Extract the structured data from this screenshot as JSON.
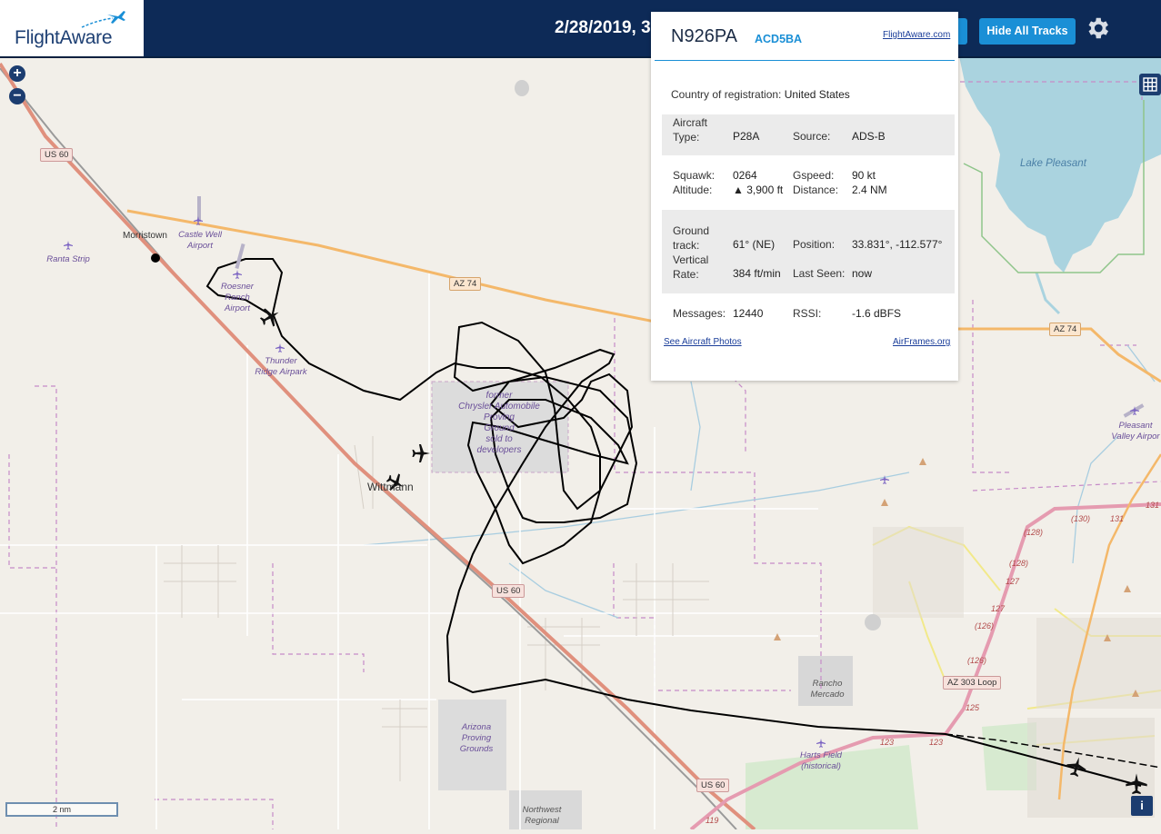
{
  "header": {
    "logo_text": "FlightAware",
    "date_text": "2/28/2019, 3",
    "hide_tracks_label": "Hide All Tracks"
  },
  "panel": {
    "tail": "N926PA",
    "hex": "ACD5BA",
    "flightaware_link": "FlightAware.com",
    "country_label": "Country of registration:",
    "country_value": "United States",
    "aircraft_type_label_1": "Aircraft",
    "aircraft_type_label_2": "Type:",
    "aircraft_type_value": "P28A",
    "source_label": "Source:",
    "source_value": "ADS-B",
    "squawk_label": "Squawk:",
    "squawk_value": "0264",
    "gspeed_label": "Gspeed:",
    "gspeed_value": "90 kt",
    "altitude_label": "Altitude:",
    "altitude_value": "▲ 3,900 ft",
    "distance_label": "Distance:",
    "distance_value": "2.4 NM",
    "ground_track_label_1": "Ground",
    "ground_track_label_2": "track:",
    "ground_track_value": "61° (NE)",
    "position_label": "Position:",
    "position_value": "33.831°, -112.577°",
    "vertical_rate_label_1": "Vertical",
    "vertical_rate_label_2": "Rate:",
    "vertical_rate_value": "384 ft/min",
    "last_seen_label": "Last Seen:",
    "last_seen_value": "now",
    "messages_label": "Messages:",
    "messages_value": "12440",
    "rssi_label": "RSSI:",
    "rssi_value": "-1.6 dBFS",
    "photos_link": "See Aircraft Photos",
    "airframes_link": "AirFrames.org"
  },
  "map": {
    "places": {
      "morristown": "Morristown",
      "wittmann": "Wittmann",
      "castle_well_1": "Castle Well",
      "castle_well_2": "Airport",
      "ranta": "Ranta Strip",
      "roesner_1": "Roesner",
      "roesner_2": "Ranch",
      "roesner_3": "Airport",
      "thunder_1": "Thunder",
      "thunder_2": "Ridge Airpark",
      "chrysler_1": "former",
      "chrysler_2": "Chrysler Automobile",
      "chrysler_3": "Proving",
      "chrysler_4": "Ground",
      "chrysler_5": "sold to",
      "chrysler_6": "developers",
      "arizona_1": "Arizona",
      "arizona_2": "Proving",
      "arizona_3": "Grounds",
      "rancho_1": "Rancho",
      "rancho_2": "Mercado",
      "harts_1": "Harts Field",
      "harts_2": "(historical)",
      "northwest_1": "Northwest",
      "northwest_2": "Regional",
      "lake": "Lake Pleasant",
      "pleasant_valley_1": "Pleasant",
      "pleasant_valley_2": "Valley Airpor"
    },
    "shields": {
      "us60_a": "US 60",
      "us60_b": "US 60",
      "us60_c": "US 60",
      "az74_a": "AZ 74",
      "az74_b": "AZ 74",
      "az303": "AZ 303 Loop"
    },
    "route_numbers": [
      "131",
      "(130)",
      "131",
      "(128)",
      "(128)",
      "127",
      "127",
      "(126)",
      "(126)",
      "125",
      "123",
      "123",
      "119"
    ],
    "scale_label": "2 nm",
    "info_label": "i",
    "zoom_in": "+",
    "zoom_out": "−"
  },
  "colors": {
    "header_bg": "#0d2a57",
    "accent": "#1a8fd6",
    "track": "#000000",
    "highway": "#e0907d",
    "state_route": "#f4b86a",
    "water": "#aad3df"
  },
  "icons": [
    "settings-gear-icon",
    "layers-grid-icon",
    "airplane-icon",
    "airport-icon",
    "info-icon",
    "zoom-in-icon",
    "zoom-out-icon"
  ]
}
